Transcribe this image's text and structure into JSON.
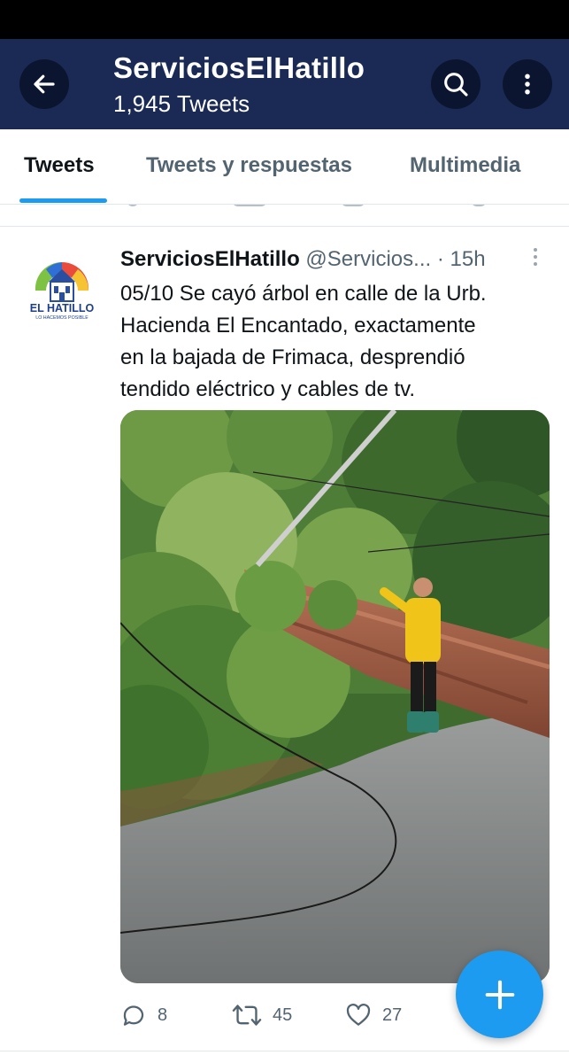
{
  "colors": {
    "header_bg": "#1b2a55",
    "accent": "#1d9bf0",
    "text": "#0f1419",
    "muted": "#536471"
  },
  "header": {
    "title": "ServiciosElHatillo",
    "subtitle": "1,945 Tweets",
    "icons": {
      "back": "arrow-left-icon",
      "search": "search-icon",
      "more": "more-vertical-icon"
    }
  },
  "tabs": [
    {
      "label": "Tweets",
      "active": true
    },
    {
      "label": "Tweets y respuestas",
      "active": false
    },
    {
      "label": "Multimedia",
      "active": false
    }
  ],
  "tweet": {
    "display_name": "ServiciosElHatillo",
    "handle": "@Servicios...",
    "separator": "·",
    "time": "15h",
    "avatar_logo": {
      "line1": "EL HATILLO",
      "line2": "LO HACEMOS POSIBLE"
    },
    "text_lines": [
      "05/10 Se cayó árbol en calle de la Urb.",
      "Hacienda El Encantado, exactamente",
      "en la bajada de Frimaca, desprendió",
      "tendido eléctrico y cables de tv."
    ],
    "stats": {
      "replies": "8",
      "retweets": "45",
      "likes": "27"
    }
  },
  "fab": {
    "icon": "plus-icon"
  }
}
